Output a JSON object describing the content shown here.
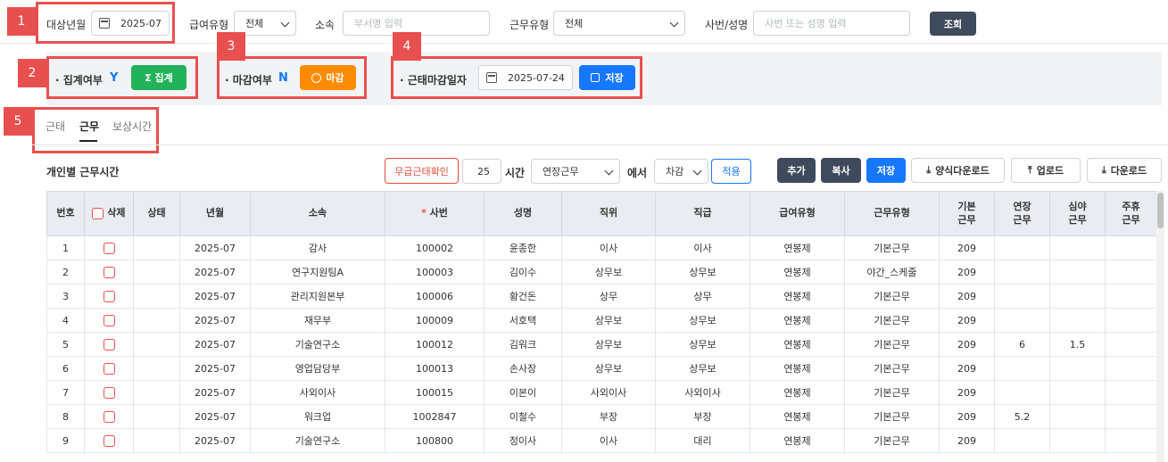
{
  "filters": {
    "target_month_label": "대상년월",
    "target_month_value": "2025-07",
    "pay_type_label": "급여유형",
    "pay_type_value": "전체",
    "dept_label": "소속",
    "dept_placeholder": "부서명 입력",
    "work_type_label": "근무유형",
    "work_type_value": "전체",
    "emp_label": "사번/성명",
    "emp_placeholder": "사번 또는 성명 입력",
    "search_button": "조회"
  },
  "status_bar": {
    "aggregate_label": "· 집계여부",
    "aggregate_value": "Y",
    "aggregate_button": "Σ 집계",
    "close_label": "· 마감여부",
    "close_value": "N",
    "close_button": "마감",
    "deadline_label": "· 근태마감일자",
    "deadline_value": "2025-07-24",
    "save_button": "저장"
  },
  "markers": [
    "1",
    "2",
    "3",
    "4",
    "5"
  ],
  "tabs": [
    "근태",
    "근무",
    "보상시간"
  ],
  "active_tab": "근무",
  "section": {
    "title": "개인별 근무시간",
    "unpaid_check_button": "무급근태확인",
    "hours_value": "25",
    "hours_unit": "시간",
    "work_select_value": "연장근무",
    "in_label": "에서",
    "mode_select_value": "차감",
    "apply_button": "적용",
    "add_button": "추가",
    "copy_button": "복사",
    "save_button": "저장",
    "template_download_button": "양식다운로드",
    "upload_button": "업로드",
    "download_button": "다운로드"
  },
  "table": {
    "headers": {
      "no": "번호",
      "delete": "삭제",
      "status": "상태",
      "month": "년월",
      "dept": "소속",
      "req_mark": "*",
      "emp_no": "사번",
      "name": "성명",
      "position": "직위",
      "grade": "직급",
      "pay_type": "급여유형",
      "work_type": "근무유형",
      "basic": [
        "기본",
        "근무"
      ],
      "overtime": [
        "연장",
        "근무"
      ],
      "night": [
        "심야",
        "근무"
      ],
      "weekly_holiday": [
        "주휴",
        "근무"
      ]
    },
    "rows": [
      {
        "no": "1",
        "status": "",
        "month": "2025-07",
        "dept": "감사",
        "emp_no": "100002",
        "name": "윤종한",
        "position": "이사",
        "grade": "이사",
        "pay_type": "연봉제",
        "work_type": "기본근무",
        "basic": "209",
        "overtime": "",
        "night": "",
        "weekly": ""
      },
      {
        "no": "2",
        "status": "",
        "month": "2025-07",
        "dept": "연구지원팀A",
        "emp_no": "100003",
        "name": "김이수",
        "position": "상무보",
        "grade": "상무보",
        "pay_type": "연봉제",
        "work_type": "야간_스케줄",
        "basic": "209",
        "overtime": "",
        "night": "",
        "weekly": ""
      },
      {
        "no": "3",
        "status": "",
        "month": "2025-07",
        "dept": "관리지원본부",
        "emp_no": "100006",
        "name": "황건돈",
        "position": "상무",
        "grade": "상무",
        "pay_type": "연봉제",
        "work_type": "기본근무",
        "basic": "209",
        "overtime": "",
        "night": "",
        "weekly": ""
      },
      {
        "no": "4",
        "status": "",
        "month": "2025-07",
        "dept": "재무부",
        "emp_no": "100009",
        "name": "서호택",
        "position": "상무보",
        "grade": "상무보",
        "pay_type": "연봉제",
        "work_type": "기본근무",
        "basic": "209",
        "overtime": "",
        "night": "",
        "weekly": ""
      },
      {
        "no": "5",
        "status": "",
        "month": "2025-07",
        "dept": "기술연구소",
        "emp_no": "100012",
        "name": "김워크",
        "position": "상무보",
        "grade": "상무보",
        "pay_type": "연봉제",
        "work_type": "기본근무",
        "basic": "209",
        "overtime": "6",
        "night": "1.5",
        "weekly": ""
      },
      {
        "no": "6",
        "status": "",
        "month": "2025-07",
        "dept": "영업담당부",
        "emp_no": "100013",
        "name": "손사장",
        "position": "상무보",
        "grade": "상무보",
        "pay_type": "연봉제",
        "work_type": "기본근무",
        "basic": "209",
        "overtime": "",
        "night": "",
        "weekly": ""
      },
      {
        "no": "7",
        "status": "",
        "month": "2025-07",
        "dept": "사외이사",
        "emp_no": "100015",
        "name": "이본이",
        "position": "사외이사",
        "grade": "사외이사",
        "pay_type": "연봉제",
        "work_type": "기본근무",
        "basic": "209",
        "overtime": "",
        "night": "",
        "weekly": ""
      },
      {
        "no": "8",
        "status": "",
        "month": "2025-07",
        "dept": "워크업",
        "emp_no": "1002847",
        "name": "이철수",
        "position": "부장",
        "grade": "부장",
        "pay_type": "연봉제",
        "work_type": "기본근무",
        "basic": "209",
        "overtime": "5.2",
        "night": "",
        "weekly": ""
      },
      {
        "no": "9",
        "status": "",
        "month": "2025-07",
        "dept": "기술연구소",
        "emp_no": "100800",
        "name": "정이사",
        "position": "이사",
        "grade": "대리",
        "pay_type": "연봉제",
        "work_type": "기본근무",
        "basic": "209",
        "overtime": "",
        "night": "",
        "weekly": ""
      }
    ]
  }
}
